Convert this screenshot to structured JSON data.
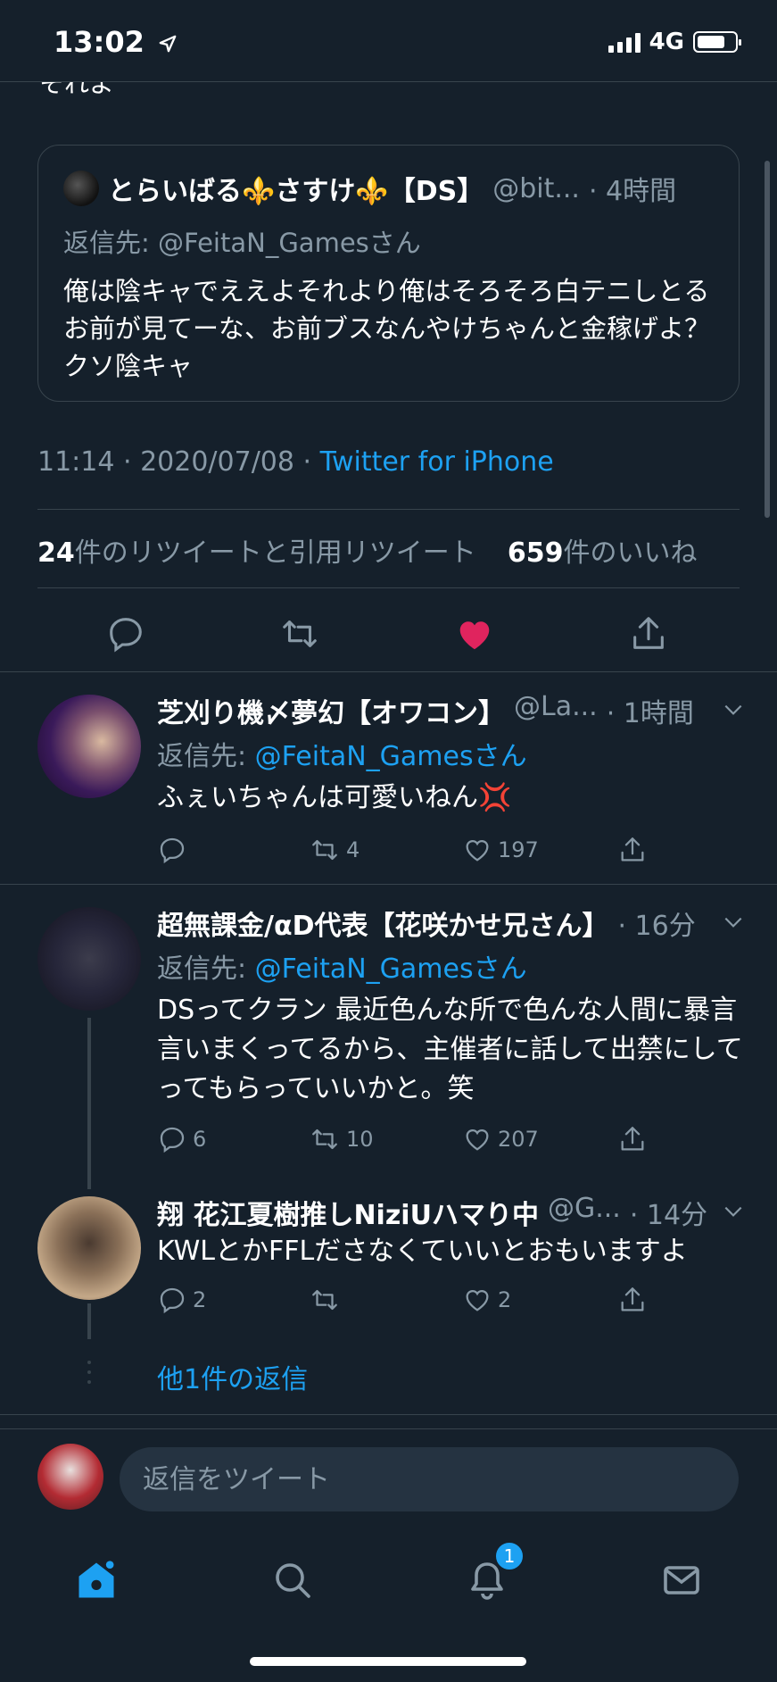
{
  "status_bar": {
    "time": "13:02",
    "network": "4G"
  },
  "cut_text": "それよ",
  "quoted_tweet": {
    "display_name": "とらいばる⚜️さすけ⚜️【DS】",
    "handle": "@bit...",
    "time": "· 4時間",
    "reply_to_prefix": "返信先: ",
    "reply_to": "@FeitaN_Gamesさん",
    "text": "俺は陰キャでええよそれより俺はそろそろ白テニしとるお前が見てーな、お前ブスなんやけちゃんと金稼げよ？クソ陰キャ"
  },
  "tweet_meta": {
    "time": "11:14 · 2020/07/08 · ",
    "source": "Twitter for iPhone"
  },
  "stats": {
    "retweets_count": "24",
    "retweets_label": "件のリツイートと引用リツイート",
    "likes_count": "659",
    "likes_label": "件のいいね"
  },
  "replies": [
    {
      "display_name": "芝刈り機〆夢幻【オワコン】",
      "handle": "@La...",
      "time": "· 1時間",
      "reply_to_prefix": "返信先: ",
      "reply_to": "@FeitaN_Gamesさん",
      "text": "ふぇいちゃんは可愛いねん💢",
      "replies": "",
      "retweets": "4",
      "likes": "197"
    },
    {
      "display_name": "超無課金/αD代表【花咲かせ兄さん】",
      "handle": "",
      "time": "· 16分",
      "reply_to_prefix": "返信先: ",
      "reply_to": "@FeitaN_Gamesさん",
      "text": "DSってクラン 最近色んな所で色んな人間に暴言言いまくってるから、主催者に話して出禁にしてってもらっていいかと。笑",
      "replies": "6",
      "retweets": "10",
      "likes": "207"
    },
    {
      "display_name": "翔 花江夏樹推しNiziUハマり中",
      "handle": "@G...",
      "time": "· 14分",
      "text": "KWLとかFFLださなくていいとおもいますよ",
      "replies": "2",
      "retweets": "",
      "likes": "2"
    }
  ],
  "more_replies": "他1件の返信",
  "composer": {
    "placeholder": "返信をツイート"
  },
  "tab_bar": {
    "notifications_badge": "1"
  },
  "colors": {
    "background": "#15202b",
    "accent": "#1da1f2",
    "like": "#e0245e",
    "muted": "#8899a6",
    "border": "#38444d"
  }
}
